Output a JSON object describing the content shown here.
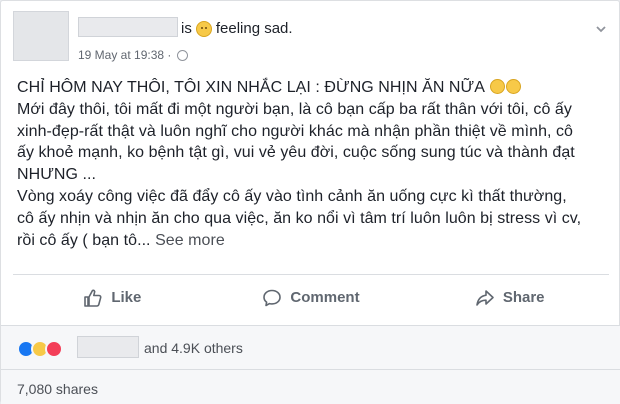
{
  "header": {
    "feeling_prefix": "is",
    "feeling_text": "feeling sad.",
    "timestamp": "19 May at 19:38 ·",
    "privacy_icon": "globe-icon",
    "menu_icon": "chevron-down-icon"
  },
  "post": {
    "lines": [
      "CHỈ HÔM NAY THÔI, TÔI XIN NHẮC LẠI : ĐỪNG NHỊN ĂN NỮA",
      "Mới đây thôi, tôi mất đi một người bạn, là cô bạn cấp ba rất thân với tôi, cô ấy",
      "xinh-đẹp-rất thật và luôn nghĩ cho người khác mà nhận phần thiệt về mình, cô",
      "ấy khoẻ mạnh, ko bệnh tật gì, vui vẻ yêu đời, cuộc sống sung túc và thành đạt",
      "NHƯNG ...",
      "Vòng xoáy công việc đã đẩy cô ấy vào tình cảnh ăn uống cực kì thất thường,",
      "cô ấy nhịn và nhịn ăn cho qua việc, ăn ko nổi vì tâm trí luôn luôn bị stress vì cv,",
      "rồi cô ấy ( bạn tô..."
    ],
    "see_more": "See more"
  },
  "actions": {
    "like": "Like",
    "comment": "Comment",
    "share": "Share"
  },
  "reactions": {
    "others_text": "and 4.9K others"
  },
  "shares": {
    "text": "7,080 shares"
  },
  "colors": {
    "like_blue": "#1877f2",
    "sad_yellow": "#f7c948",
    "love_red": "#f33e58"
  }
}
